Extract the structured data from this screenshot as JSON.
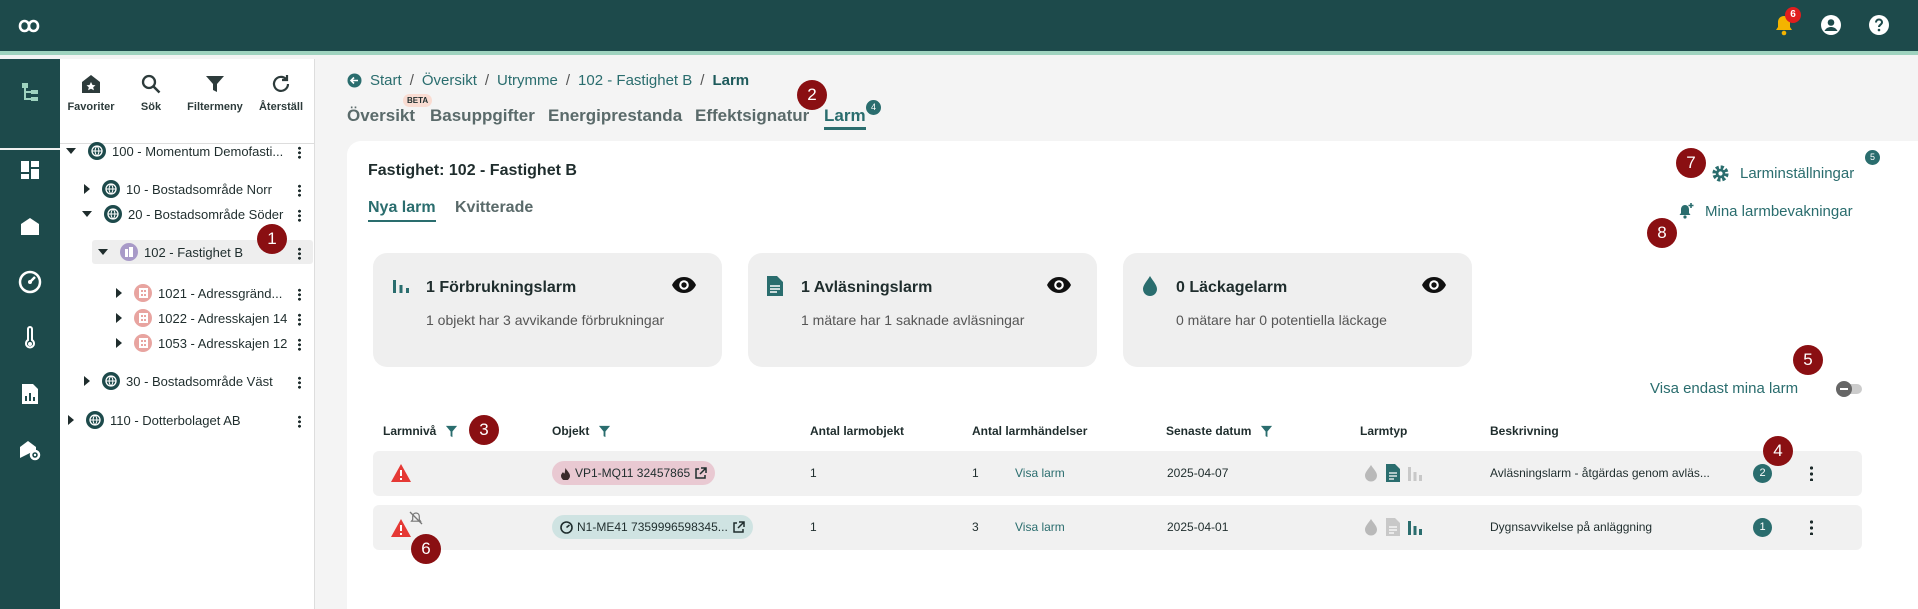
{
  "topbar": {
    "notification_count": "6"
  },
  "tree_toolbar": {
    "favorites": "Favoriter",
    "search": "Sök",
    "filter": "Filtermeny",
    "reset": "Återställ"
  },
  "tree": [
    {
      "label": "100 - Momentum Demofasti...",
      "icon": "globe-icon"
    },
    {
      "label": "10 - Bostadsområde Norr",
      "icon": "globe-icon"
    },
    {
      "label": "20 - Bostadsområde Söder",
      "icon": "globe-icon"
    },
    {
      "label": "102 - Fastighet B",
      "icon": "building-icon"
    },
    {
      "label": "1021 - Adressgränd...",
      "icon": "apartment-icon"
    },
    {
      "label": "1022 - Adresskajen 14",
      "icon": "apartment-icon"
    },
    {
      "label": "1053 - Adresskajen 12",
      "icon": "apartment-icon"
    },
    {
      "label": "30 - Bostadsområde Väst",
      "icon": "globe-icon"
    },
    {
      "label": "110 - Dotterbolaget AB",
      "icon": "globe-icon"
    }
  ],
  "breadcrumb": [
    "Start",
    "Översikt",
    "Utrymme",
    "102 - Fastighet B",
    "Larm"
  ],
  "tabs": {
    "overview": "Översikt",
    "beta": "BETA",
    "base": "Basuppgifter",
    "energy": "Energiprestanda",
    "effect": "Effektsignatur",
    "alarm": "Larm",
    "alarm_count": "4"
  },
  "property_title": "Fastighet: 102 - Fastighet B",
  "subtabs": {
    "new": "Nya larm",
    "acknowledged": "Kvitterade"
  },
  "settings": {
    "label": "Larminställningar",
    "count": "5"
  },
  "watch": {
    "label": "Mina larmbevakningar"
  },
  "kpis": [
    {
      "title": "1 Förbrukningslarm",
      "subtitle": "1 objekt har 3 avvikande förbrukningar",
      "icon": "bar-chart-icon"
    },
    {
      "title": "1 Avläsningslarm",
      "subtitle": "1 mätare har 1 saknade avläsningar",
      "icon": "document-icon"
    },
    {
      "title": "0 Läckagelarm",
      "subtitle": "0 mätare har 0 potentiella läckage",
      "icon": "water-drop-icon"
    }
  ],
  "filter_toggle": {
    "label": "Visa endast mina larm",
    "on": false
  },
  "table": {
    "headers": [
      "Larmnivå",
      "Objekt",
      "Antal larmobjekt",
      "Antal larmhändelser",
      "Senaste datum",
      "Larmtyp",
      "Beskrivning"
    ],
    "rows": [
      {
        "object": "VP1-MQ11 32457865",
        "alarm_objects": "1",
        "alarm_events": "1",
        "link": "Visa larm",
        "date": "2025-04-07",
        "description": "Avläsningslarm - åtgärdas genom avläs...",
        "count": "2"
      },
      {
        "object": "N1-ME41 7359996598345...",
        "alarm_objects": "1",
        "alarm_events": "3",
        "link": "Visa larm",
        "date": "2025-04-01",
        "description": "Dygnsavvikelse på anläggning",
        "count": "1"
      }
    ]
  },
  "callouts": [
    "1",
    "2",
    "3",
    "4",
    "5",
    "6",
    "7",
    "8"
  ],
  "colors": {
    "primary": "#1d4a4b",
    "accent": "#2a6d6e",
    "callout": "#8a0f12",
    "warning": "#e53935"
  }
}
